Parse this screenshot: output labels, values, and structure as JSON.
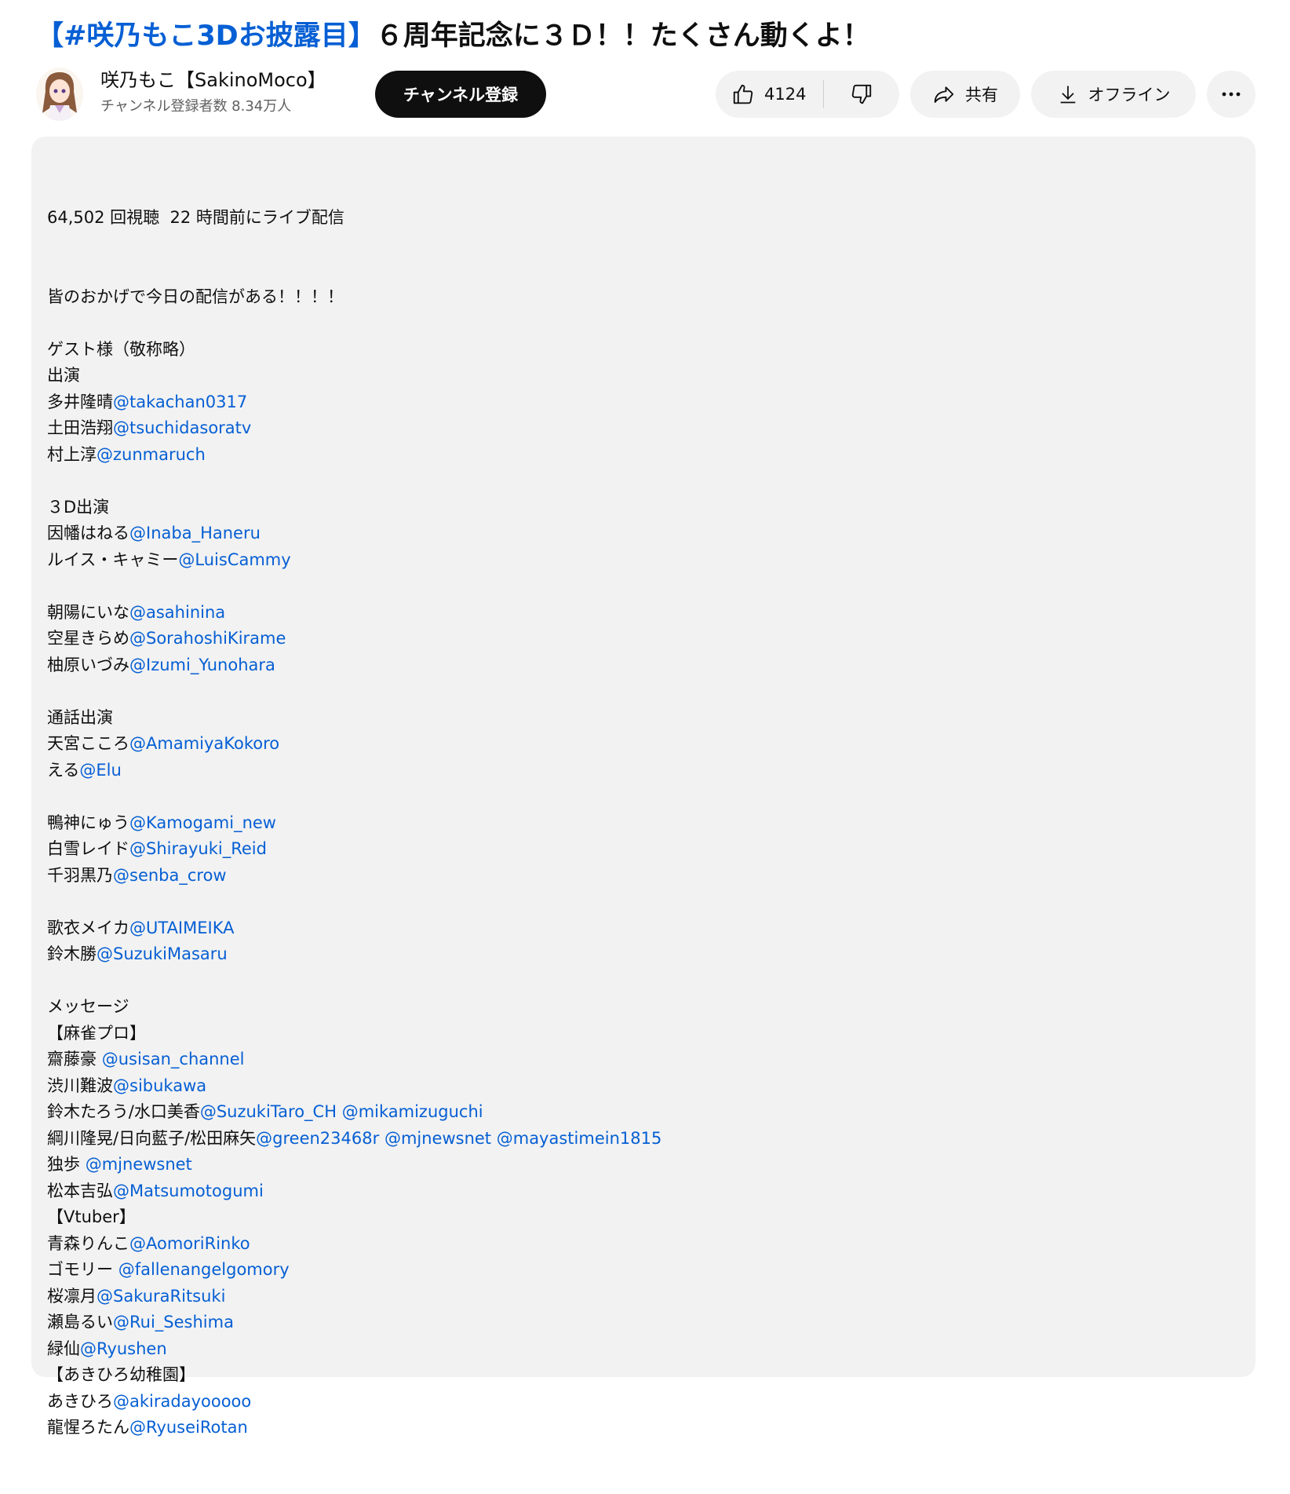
{
  "video": {
    "title_hashtag": "【#咲乃もこ3Dお披露目】",
    "title_rest": "６周年記念に３Ｄ！！たくさん動くよ！"
  },
  "channel": {
    "name": "咲乃もこ【SakinoMoco】",
    "subscribers": "チャンネル登録者数 8.34万人",
    "subscribe_label": "チャンネル登録"
  },
  "actions": {
    "like_count": "4124",
    "share_label": "共有",
    "offline_label": "オフライン",
    "more_label": "…"
  },
  "description": {
    "meta": "64,502 回視聴  22 時間前にライブ配信",
    "lines": [
      [
        {
          "t": "皆のおかげで今日の配信がある！！！！"
        }
      ],
      [],
      [
        {
          "t": "ゲスト様（敬称略）"
        }
      ],
      [
        {
          "t": "出演"
        }
      ],
      [
        {
          "t": "多井隆晴"
        },
        {
          "t": "@takachan0317",
          "m": true
        }
      ],
      [
        {
          "t": "土田浩翔"
        },
        {
          "t": "@tsuchidasoratv",
          "m": true
        }
      ],
      [
        {
          "t": "村上淳"
        },
        {
          "t": "@zunmaruch",
          "m": true
        }
      ],
      [],
      [
        {
          "t": "３D出演"
        }
      ],
      [
        {
          "t": "因幡はねる"
        },
        {
          "t": "@Inaba_Haneru",
          "m": true
        }
      ],
      [
        {
          "t": "ルイス・キャミー"
        },
        {
          "t": "@LuisCammy",
          "m": true
        }
      ],
      [],
      [
        {
          "t": "朝陽にいな"
        },
        {
          "t": "@asahinina",
          "m": true
        }
      ],
      [
        {
          "t": "空星きらめ"
        },
        {
          "t": "@SorahoshiKirame",
          "m": true
        }
      ],
      [
        {
          "t": "柚原いづみ"
        },
        {
          "t": "@Izumi_Yunohara",
          "m": true
        }
      ],
      [],
      [
        {
          "t": "通話出演"
        }
      ],
      [
        {
          "t": "天宮こころ"
        },
        {
          "t": "@AmamiyaKokoro",
          "m": true
        }
      ],
      [
        {
          "t": "える"
        },
        {
          "t": "@Elu",
          "m": true
        }
      ],
      [],
      [
        {
          "t": "鴨神にゅう"
        },
        {
          "t": "@Kamogami_new",
          "m": true
        }
      ],
      [
        {
          "t": "白雪レイド"
        },
        {
          "t": "@Shirayuki_Reid",
          "m": true
        }
      ],
      [
        {
          "t": "千羽黒乃"
        },
        {
          "t": "@senba_crow",
          "m": true
        }
      ],
      [],
      [
        {
          "t": "歌衣メイカ"
        },
        {
          "t": "@UTAIMEIKA",
          "m": true
        }
      ],
      [
        {
          "t": "鈴木勝"
        },
        {
          "t": "@SuzukiMasaru",
          "m": true
        }
      ],
      [],
      [
        {
          "t": "メッセージ"
        }
      ],
      [
        {
          "t": "【麻雀プロ】"
        }
      ],
      [
        {
          "t": "齋藤豪 "
        },
        {
          "t": "@usisan_channel",
          "m": true
        }
      ],
      [
        {
          "t": "渋川難波"
        },
        {
          "t": "@sibukawa",
          "m": true
        }
      ],
      [
        {
          "t": "鈴木たろう/水口美香"
        },
        {
          "t": "@SuzukiTaro_CH",
          "m": true
        },
        {
          "t": " "
        },
        {
          "t": "@mikamizuguchi",
          "m": true
        }
      ],
      [
        {
          "t": "綱川隆晃/日向藍子/松田麻矢"
        },
        {
          "t": "@green23468r",
          "m": true
        },
        {
          "t": " "
        },
        {
          "t": "@mjnewsnet",
          "m": true
        },
        {
          "t": " "
        },
        {
          "t": "@mayastimein1815",
          "m": true
        }
      ],
      [
        {
          "t": "独歩 "
        },
        {
          "t": "@mjnewsnet",
          "m": true
        }
      ],
      [
        {
          "t": "松本吉弘"
        },
        {
          "t": "@Matsumotogumi",
          "m": true
        }
      ],
      [
        {
          "t": "【Vtuber】"
        }
      ],
      [
        {
          "t": "青森りんこ"
        },
        {
          "t": "@AomoriRinko",
          "m": true
        }
      ],
      [
        {
          "t": "ゴモリー "
        },
        {
          "t": "@fallenangelgomory",
          "m": true
        }
      ],
      [
        {
          "t": "桜凛月"
        },
        {
          "t": "@SakuraRitsuki",
          "m": true
        }
      ],
      [
        {
          "t": "瀬島るい"
        },
        {
          "t": "@Rui_Seshima",
          "m": true
        }
      ],
      [
        {
          "t": "緑仙"
        },
        {
          "t": "@Ryushen",
          "m": true
        }
      ],
      [
        {
          "t": "【あきひろ幼稚園】"
        }
      ],
      [
        {
          "t": "あきひろ"
        },
        {
          "t": "@akiradayooooo",
          "m": true
        }
      ],
      [
        {
          "t": "龍惺ろたん"
        },
        {
          "t": "@RyuseiRotan",
          "m": true
        }
      ]
    ]
  },
  "colors": {
    "link": "#065fd4",
    "pill_bg": "#f2f2f2",
    "subscribe_bg": "#0f0f0f"
  },
  "icons": {
    "like": "thumbs-up-icon",
    "dislike": "thumbs-down-icon",
    "share": "share-arrow-icon",
    "download": "download-icon",
    "more": "more-horizontal-icon"
  }
}
